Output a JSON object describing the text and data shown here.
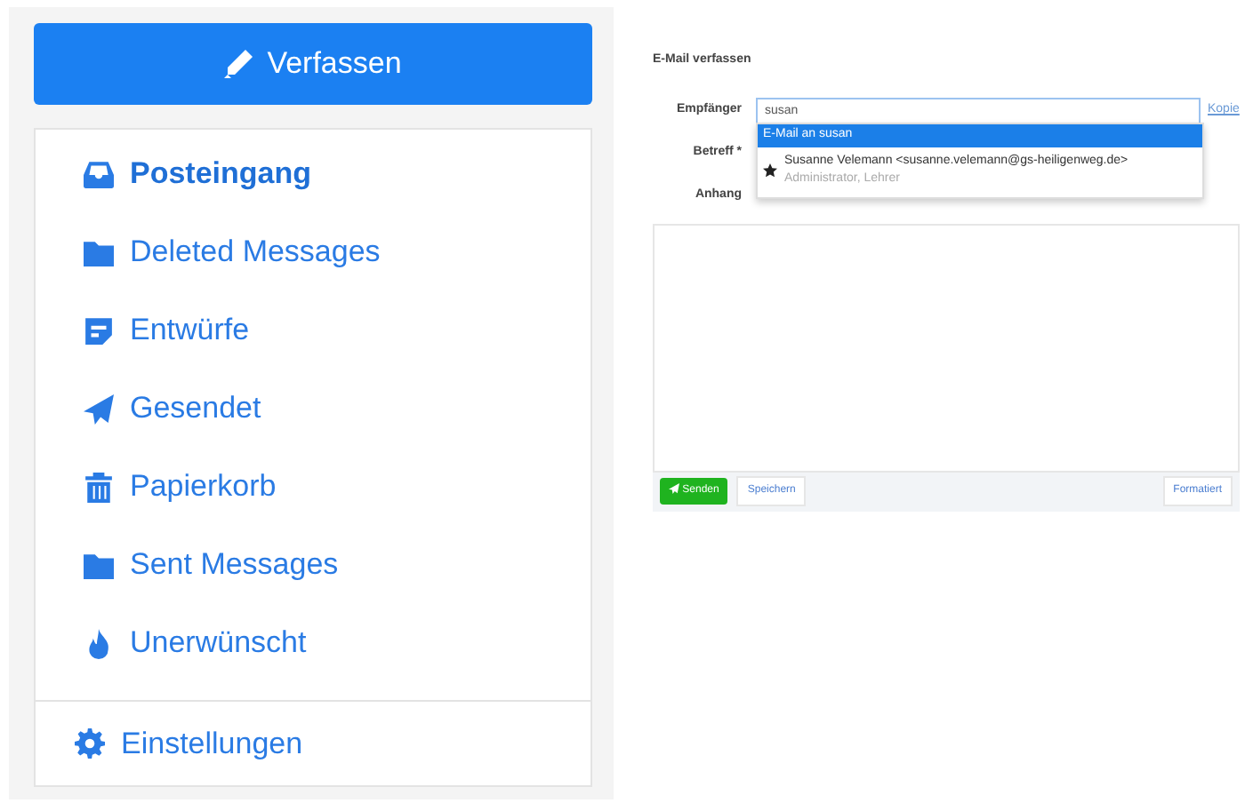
{
  "sidebar": {
    "compose_button": {
      "label": "Verfassen"
    },
    "folders": [
      {
        "label": "Posteingang",
        "kind": "inbox",
        "selected": true
      },
      {
        "label": "Deleted Messages",
        "kind": "folder",
        "selected": false
      },
      {
        "label": "Entwürfe",
        "kind": "draft",
        "selected": false
      },
      {
        "label": "Gesendet",
        "kind": "send",
        "selected": false
      },
      {
        "label": "Papierkorb",
        "kind": "trash",
        "selected": false
      },
      {
        "label": "Sent Messages",
        "kind": "folder",
        "selected": false
      },
      {
        "label": "Unerwünscht",
        "kind": "fire",
        "selected": false
      }
    ],
    "settings": {
      "label": "Einstellungen"
    }
  },
  "compose": {
    "title": "E-Mail verfassen",
    "recipient": {
      "label": "Empfänger",
      "value": "susan",
      "cc_link": "Kopie"
    },
    "suggestions": [
      {
        "kind": "plain",
        "text": "E-Mail an susan",
        "selected": true
      },
      {
        "kind": "contact",
        "text": "Susanne Velemann <susanne.velemann@gs-heiligenweg.de>",
        "detail": "Administrator, Lehrer",
        "selected": false
      }
    ],
    "subject": {
      "label": "Betreff *"
    },
    "attachment": {
      "label": "Anhang"
    },
    "buttons": {
      "send": "Senden",
      "save": "Speichern",
      "format": "Formatiert"
    }
  }
}
